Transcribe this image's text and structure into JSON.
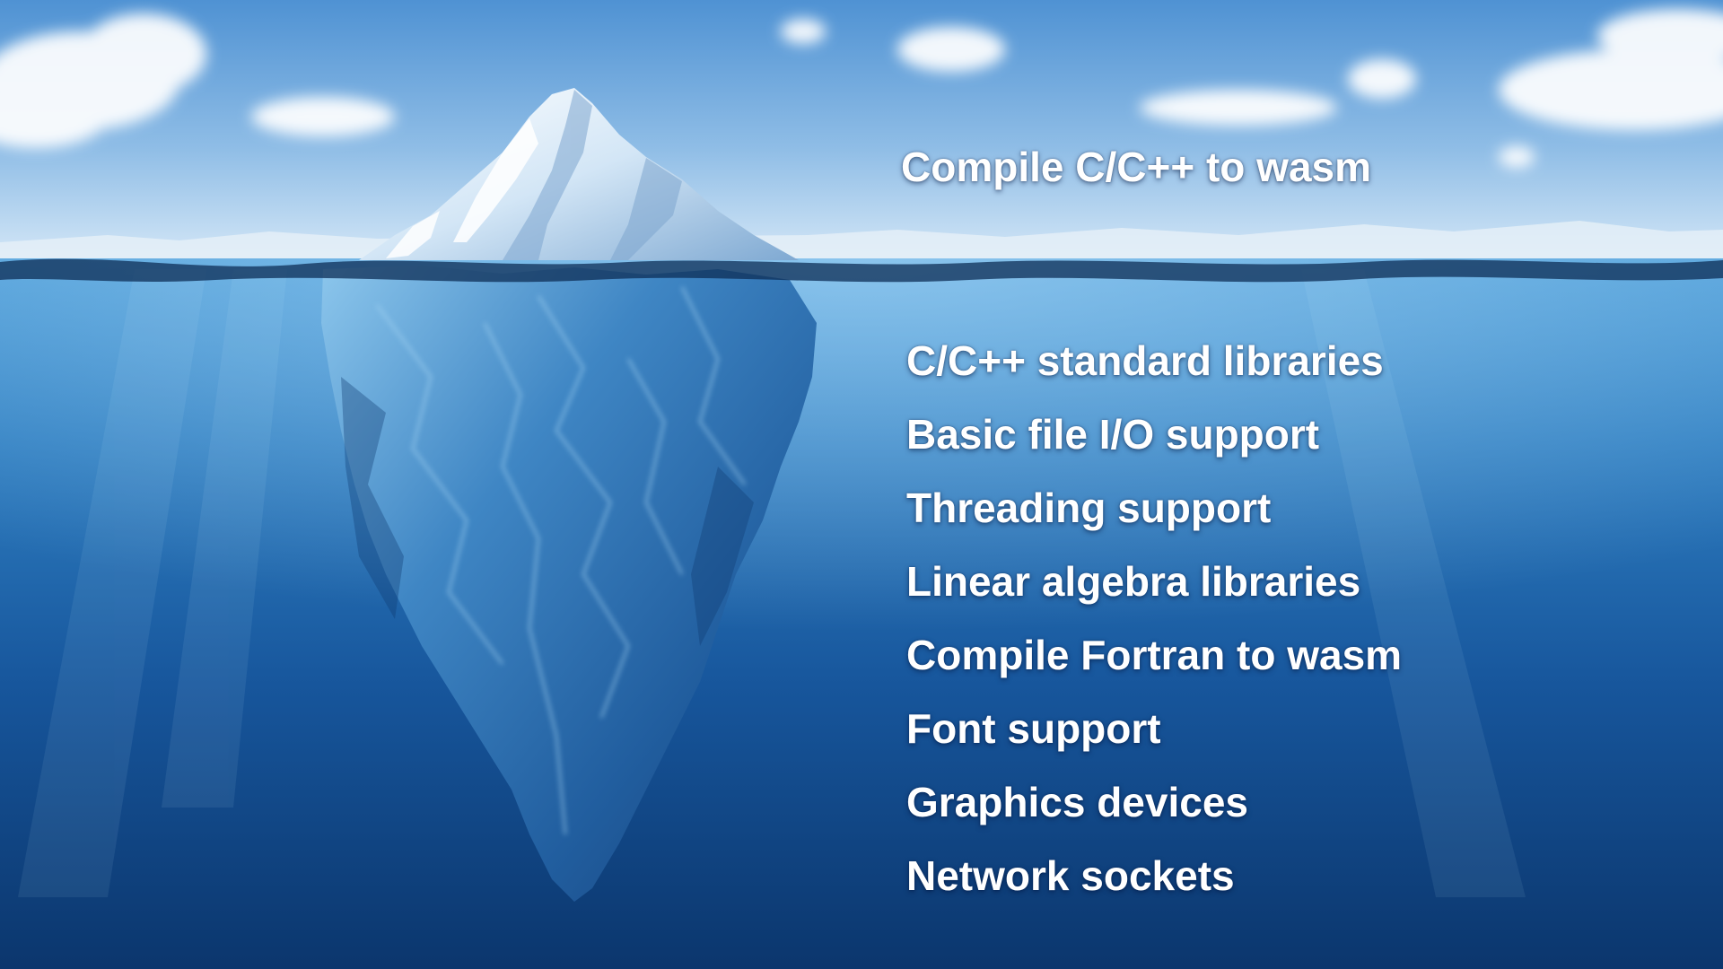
{
  "slide": {
    "above_water_text": "Compile C/C++ to wasm",
    "below_water_items": [
      "C/C++ standard libraries",
      "Basic file I/O support",
      "Threading support",
      "Linear algebra libraries",
      "Compile Fortran to wasm",
      "Font support",
      "Graphics devices",
      "Network sockets"
    ],
    "colors": {
      "sky_top": "#5b9ad6",
      "sky_horizon": "#d7e8f7",
      "water_surface": "#3f8fd0",
      "water_deep": "#0c3a74",
      "ice_light": "#eaf5fd",
      "ice_shadow": "#1d4f8e",
      "text": "#ffffff"
    },
    "icons": [
      "iceberg-illustration"
    ]
  }
}
